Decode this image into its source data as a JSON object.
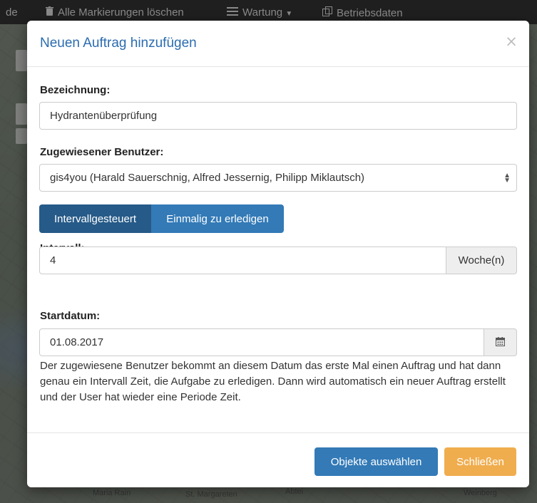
{
  "topbar": {
    "left_fragment": "de",
    "items": [
      {
        "label": "Alle Markierungen löschen",
        "icon": "trash-icon"
      },
      {
        "label": "Wartung",
        "icon": "list-icon"
      },
      {
        "label": "Betriebsdaten",
        "icon": "copy-icon"
      }
    ]
  },
  "map_labels": {
    "bottom_1": "Maria Rain",
    "bottom_2": "St. Margareten",
    "bottom_3": "Abtei",
    "bottom_4": "Weinberg"
  },
  "modal": {
    "title": "Neuen Auftrag hinzufügen",
    "close_symbol": "×",
    "bezeichnung": {
      "label": "Bezeichnung:",
      "value": "Hydrantenüberprüfung"
    },
    "benutzer": {
      "label": "Zugewiesener Benutzer:",
      "selected": "gis4you (Harald Sauerschnig, Alfred Jessernig, Philipp Miklautsch)"
    },
    "mode": {
      "option_1": "Intervallgesteuert",
      "option_2": "Einmalig zu erledigen",
      "active": "Intervallgesteuert"
    },
    "intervall": {
      "label": "Intervall:",
      "value": "4",
      "unit": "Woche(n)"
    },
    "startdatum": {
      "label": "Startdatum:",
      "value": "01.08.2017",
      "icon": "calendar-icon"
    },
    "help_text": "Der zugewiesene Benutzer bekommt an diesem Datum das erste Mal einen Auftrag und hat dann genau ein Intervall Zeit, die Aufgabe zu erledigen. Dann wird automatisch ein neuer Auftrag erstellt und der User hat wieder eine Periode Zeit.",
    "footer": {
      "primary_label": "Objekte auswählen",
      "close_label": "Schließen"
    }
  },
  "colors": {
    "title": "#2b6cb0",
    "primary": "#337ab7",
    "primary_active": "#265a88",
    "warning": "#f0ad4e"
  }
}
